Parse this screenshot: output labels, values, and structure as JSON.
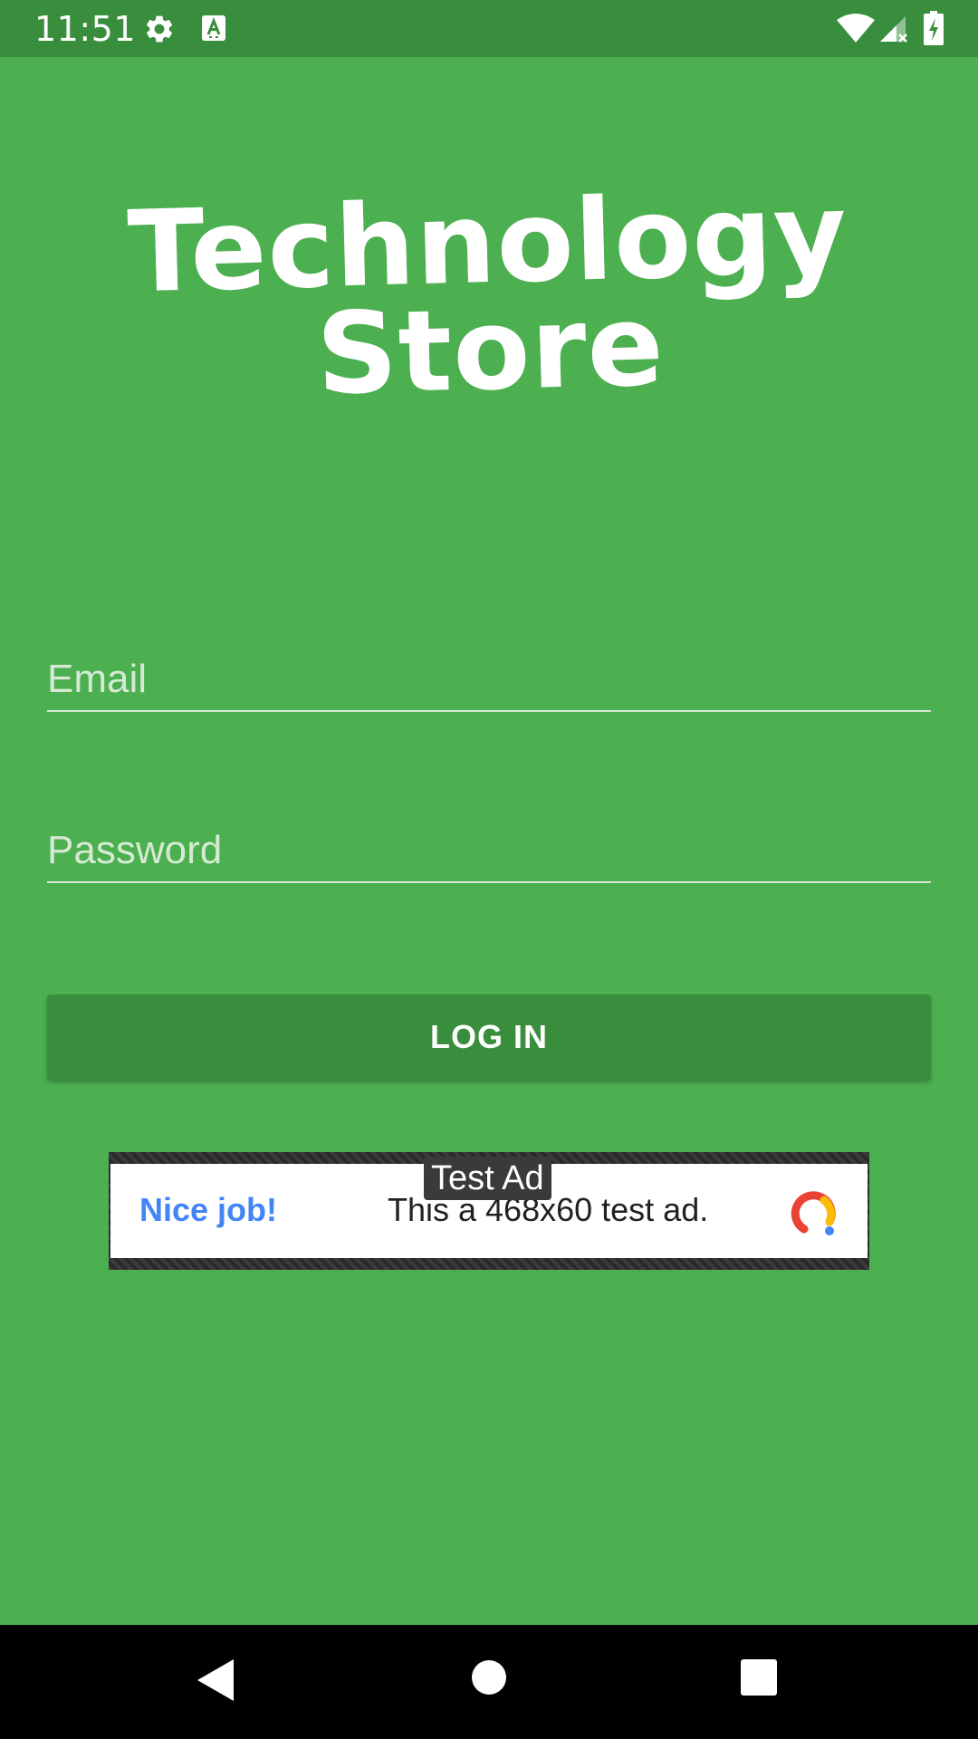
{
  "status_bar": {
    "time": "11:51",
    "icons": [
      "gear-icon",
      "a-badge-icon",
      "wifi-icon",
      "signal-icon",
      "battery-charging-icon"
    ]
  },
  "app": {
    "title_line1": "Technology",
    "title_line2": "Store"
  },
  "form": {
    "email_placeholder": "Email",
    "email_value": "",
    "password_placeholder": "Password",
    "password_value": "",
    "login_label": "LOG IN"
  },
  "ad": {
    "label": "Test Ad",
    "headline": "Nice job!",
    "text": "This a 468x60 test ad."
  },
  "nav_bar": {
    "icons": [
      "back-icon",
      "home-icon",
      "recents-icon"
    ]
  },
  "colors": {
    "background": "#4caf50",
    "status_bar": "#388e3c",
    "button": "#388e3c",
    "ad_headline": "#4285f4"
  }
}
